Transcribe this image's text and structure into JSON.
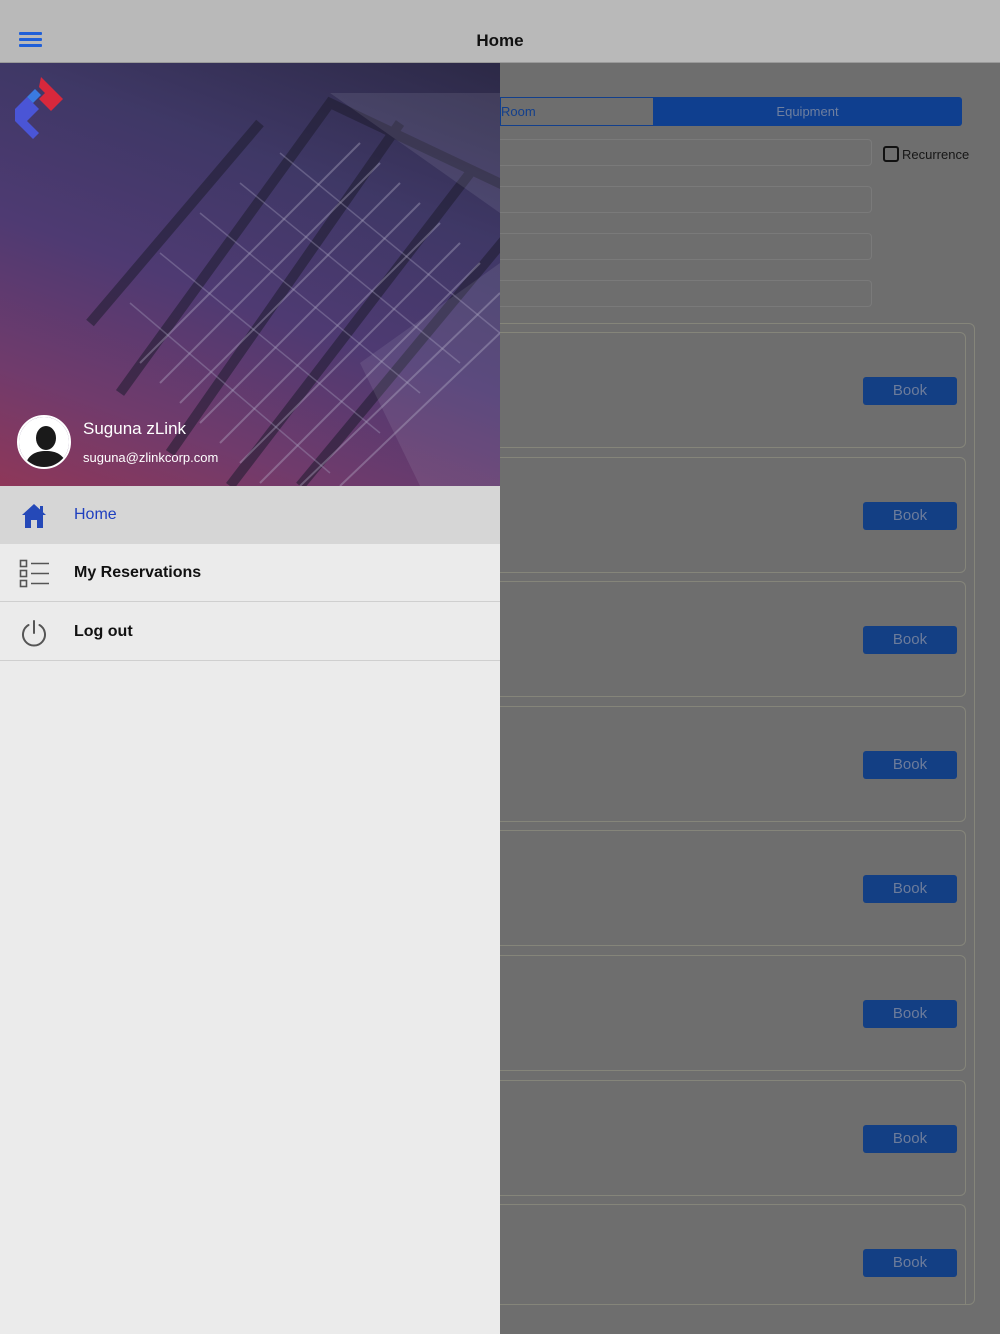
{
  "navbar": {
    "title": "Home",
    "menu_icon": "hamburger-menu-icon"
  },
  "drawer": {
    "user": {
      "name": "Suguna zLink",
      "email": "suguna@zlinkcorp.com"
    },
    "items": [
      {
        "label": "Home",
        "icon": "home-icon",
        "active": true
      },
      {
        "label": "My Reservations",
        "icon": "list-icon",
        "active": false
      },
      {
        "label": "Log out",
        "icon": "power-icon",
        "active": false
      }
    ]
  },
  "main": {
    "tabs": [
      {
        "label": "Room"
      },
      {
        "label": "Equipment"
      }
    ],
    "recurrence_label": "Recurrence",
    "book_label": "Book"
  },
  "colors": {
    "accent": "#1f5fd8",
    "active_menu_text": "#1f3fbf",
    "book_button": "#133f84"
  }
}
